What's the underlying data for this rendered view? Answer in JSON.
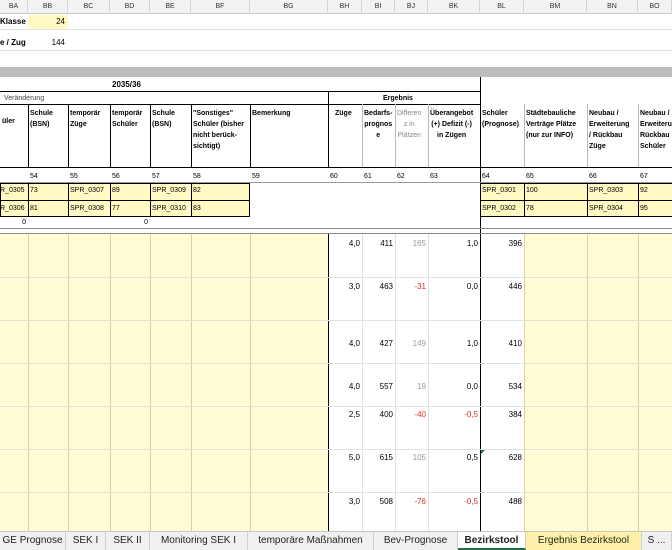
{
  "columns": [
    "BA",
    "BB",
    "BC",
    "BD",
    "BE",
    "BF",
    "BG",
    "BH",
    "BI",
    "BJ",
    "BK",
    "BL",
    "BM",
    "BN",
    "BO"
  ],
  "top": {
    "label1": "Klasse",
    "value1": "24",
    "label2": "e / Zug",
    "value2": "144"
  },
  "header": {
    "year": "2035/36",
    "group_veraenderung": "Veränderung",
    "group_ergebnis": "Ergebnis",
    "col_a": "üler",
    "col_b": "Schule\n(BSN)",
    "col_c": "temporär\nZüge",
    "col_d": "temporär\nSchüler",
    "col_e": "Schule\n(BSN)",
    "col_f": "\"Sonstiges\"\nSchüler (bisher\nnicht berück-\nsichtigt)",
    "col_g": "Bemerkung",
    "col_h": "Züge",
    "col_i": "Bedarfs-\nprognos\ne",
    "col_j": "Differen\nz in\nPlätzen",
    "col_k": "Überangebot\n(+) Defizit (-)\nin Zügen",
    "col_l": "Schüler\n(Prognose)",
    "col_m": "Städtebauliche\nVerträge Plätze\n(nur zur INFO)",
    "col_n": "Neubau /\nErweiterung\n/ Rückbau\nZüge",
    "col_o": "Neubau /\nErweiterun\nRückbau\nSchüler"
  },
  "numbers_row": [
    "54",
    "55",
    "56",
    "57",
    "58",
    "59",
    "60",
    "61",
    "62",
    "63",
    "64",
    "65",
    "66",
    "67"
  ],
  "spr_rows": [
    {
      "a": "R_0305",
      "b": "73",
      "c": "SPR_0307",
      "d": "89",
      "e": "SPR_0309",
      "f": "82",
      "l": "SPR_0301",
      "m": "100",
      "n": "SPR_0303",
      "o": "92"
    },
    {
      "a": "R_0306",
      "b": "81",
      "c": "SPR_0308",
      "d": "77",
      "e": "SPR_0310",
      "f": "83",
      "l": "SPR_0302",
      "m": "78",
      "n": "SPR_0304",
      "o": "95"
    }
  ],
  "zero_row": [
    "0",
    "0"
  ],
  "data_rows": [
    {
      "zuege": "4,0",
      "bedarf": "411",
      "diff": "165",
      "ueber": "1,0",
      "schueler": "396",
      "diff_neg": false
    },
    {
      "zuege": "3,0",
      "bedarf": "463",
      "diff": "-31",
      "ueber": "0,0",
      "schueler": "446",
      "diff_neg": true
    },
    {
      "zuege": "4,0",
      "bedarf": "427",
      "diff": "149",
      "ueber": "1,0",
      "schueler": "410",
      "diff_neg": false
    },
    {
      "zuege": "4,0",
      "bedarf": "557",
      "diff": "19",
      "ueber": "0,0",
      "schueler": "534",
      "diff_neg": false
    },
    {
      "zuege": "2,5",
      "bedarf": "400",
      "diff": "-40",
      "ueber": "-0,5",
      "schueler": "384",
      "diff_neg": true
    },
    {
      "zuege": "5,0",
      "bedarf": "615",
      "diff": "105",
      "ueber": "0,5",
      "schueler": "628",
      "diff_neg": false
    },
    {
      "zuege": "3,0",
      "bedarf": "508",
      "diff": "-76",
      "ueber": "-0,5",
      "schueler": "488",
      "diff_neg": true
    }
  ],
  "tabs": [
    {
      "label": "GE Prognose",
      "active": false
    },
    {
      "label": "SEK I",
      "active": false
    },
    {
      "label": "SEK II",
      "active": false
    },
    {
      "label": "Monitoring SEK I",
      "active": false
    },
    {
      "label": "temporäre Maßnahmen",
      "active": false
    },
    {
      "label": "Bev-Prognose",
      "active": false
    },
    {
      "label": "Bezirkstool",
      "active": true
    },
    {
      "label": "Ergebnis Bezirkstool",
      "active": false,
      "yellow": true
    },
    {
      "label": "S ...",
      "active": false
    }
  ],
  "colors": {
    "accent_green": "#1e7145",
    "yellow": "#fff9c4",
    "negative": "#e03030"
  }
}
